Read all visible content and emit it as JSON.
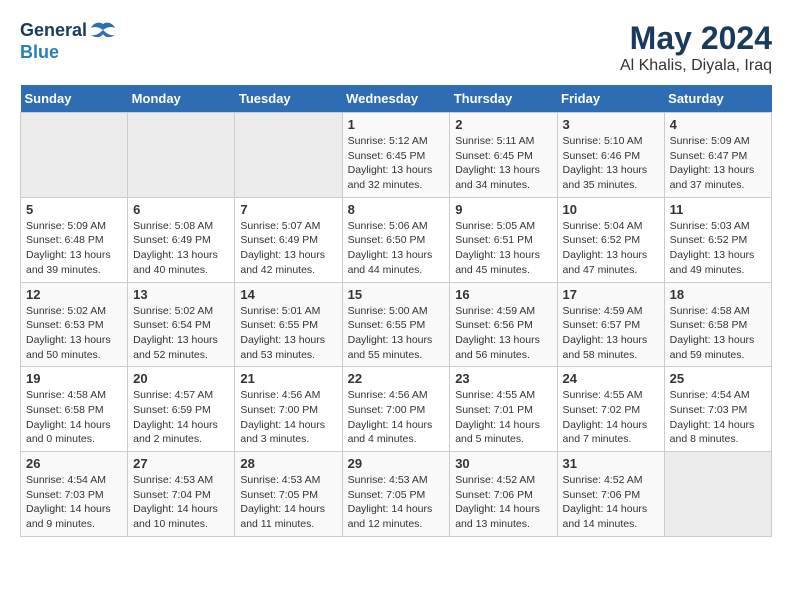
{
  "logo": {
    "line1": "General",
    "line2": "Blue"
  },
  "title": "May 2024",
  "subtitle": "Al Khalis, Diyala, Iraq",
  "weekdays": [
    "Sunday",
    "Monday",
    "Tuesday",
    "Wednesday",
    "Thursday",
    "Friday",
    "Saturday"
  ],
  "weeks": [
    [
      {
        "day": "",
        "info": ""
      },
      {
        "day": "",
        "info": ""
      },
      {
        "day": "",
        "info": ""
      },
      {
        "day": "1",
        "info": "Sunrise: 5:12 AM\nSunset: 6:45 PM\nDaylight: 13 hours and 32 minutes."
      },
      {
        "day": "2",
        "info": "Sunrise: 5:11 AM\nSunset: 6:45 PM\nDaylight: 13 hours and 34 minutes."
      },
      {
        "day": "3",
        "info": "Sunrise: 5:10 AM\nSunset: 6:46 PM\nDaylight: 13 hours and 35 minutes."
      },
      {
        "day": "4",
        "info": "Sunrise: 5:09 AM\nSunset: 6:47 PM\nDaylight: 13 hours and 37 minutes."
      }
    ],
    [
      {
        "day": "5",
        "info": "Sunrise: 5:09 AM\nSunset: 6:48 PM\nDaylight: 13 hours and 39 minutes."
      },
      {
        "day": "6",
        "info": "Sunrise: 5:08 AM\nSunset: 6:49 PM\nDaylight: 13 hours and 40 minutes."
      },
      {
        "day": "7",
        "info": "Sunrise: 5:07 AM\nSunset: 6:49 PM\nDaylight: 13 hours and 42 minutes."
      },
      {
        "day": "8",
        "info": "Sunrise: 5:06 AM\nSunset: 6:50 PM\nDaylight: 13 hours and 44 minutes."
      },
      {
        "day": "9",
        "info": "Sunrise: 5:05 AM\nSunset: 6:51 PM\nDaylight: 13 hours and 45 minutes."
      },
      {
        "day": "10",
        "info": "Sunrise: 5:04 AM\nSunset: 6:52 PM\nDaylight: 13 hours and 47 minutes."
      },
      {
        "day": "11",
        "info": "Sunrise: 5:03 AM\nSunset: 6:52 PM\nDaylight: 13 hours and 49 minutes."
      }
    ],
    [
      {
        "day": "12",
        "info": "Sunrise: 5:02 AM\nSunset: 6:53 PM\nDaylight: 13 hours and 50 minutes."
      },
      {
        "day": "13",
        "info": "Sunrise: 5:02 AM\nSunset: 6:54 PM\nDaylight: 13 hours and 52 minutes."
      },
      {
        "day": "14",
        "info": "Sunrise: 5:01 AM\nSunset: 6:55 PM\nDaylight: 13 hours and 53 minutes."
      },
      {
        "day": "15",
        "info": "Sunrise: 5:00 AM\nSunset: 6:55 PM\nDaylight: 13 hours and 55 minutes."
      },
      {
        "day": "16",
        "info": "Sunrise: 4:59 AM\nSunset: 6:56 PM\nDaylight: 13 hours and 56 minutes."
      },
      {
        "day": "17",
        "info": "Sunrise: 4:59 AM\nSunset: 6:57 PM\nDaylight: 13 hours and 58 minutes."
      },
      {
        "day": "18",
        "info": "Sunrise: 4:58 AM\nSunset: 6:58 PM\nDaylight: 13 hours and 59 minutes."
      }
    ],
    [
      {
        "day": "19",
        "info": "Sunrise: 4:58 AM\nSunset: 6:58 PM\nDaylight: 14 hours and 0 minutes."
      },
      {
        "day": "20",
        "info": "Sunrise: 4:57 AM\nSunset: 6:59 PM\nDaylight: 14 hours and 2 minutes."
      },
      {
        "day": "21",
        "info": "Sunrise: 4:56 AM\nSunset: 7:00 PM\nDaylight: 14 hours and 3 minutes."
      },
      {
        "day": "22",
        "info": "Sunrise: 4:56 AM\nSunset: 7:00 PM\nDaylight: 14 hours and 4 minutes."
      },
      {
        "day": "23",
        "info": "Sunrise: 4:55 AM\nSunset: 7:01 PM\nDaylight: 14 hours and 5 minutes."
      },
      {
        "day": "24",
        "info": "Sunrise: 4:55 AM\nSunset: 7:02 PM\nDaylight: 14 hours and 7 minutes."
      },
      {
        "day": "25",
        "info": "Sunrise: 4:54 AM\nSunset: 7:03 PM\nDaylight: 14 hours and 8 minutes."
      }
    ],
    [
      {
        "day": "26",
        "info": "Sunrise: 4:54 AM\nSunset: 7:03 PM\nDaylight: 14 hours and 9 minutes."
      },
      {
        "day": "27",
        "info": "Sunrise: 4:53 AM\nSunset: 7:04 PM\nDaylight: 14 hours and 10 minutes."
      },
      {
        "day": "28",
        "info": "Sunrise: 4:53 AM\nSunset: 7:05 PM\nDaylight: 14 hours and 11 minutes."
      },
      {
        "day": "29",
        "info": "Sunrise: 4:53 AM\nSunset: 7:05 PM\nDaylight: 14 hours and 12 minutes."
      },
      {
        "day": "30",
        "info": "Sunrise: 4:52 AM\nSunset: 7:06 PM\nDaylight: 14 hours and 13 minutes."
      },
      {
        "day": "31",
        "info": "Sunrise: 4:52 AM\nSunset: 7:06 PM\nDaylight: 14 hours and 14 minutes."
      },
      {
        "day": "",
        "info": ""
      }
    ]
  ]
}
